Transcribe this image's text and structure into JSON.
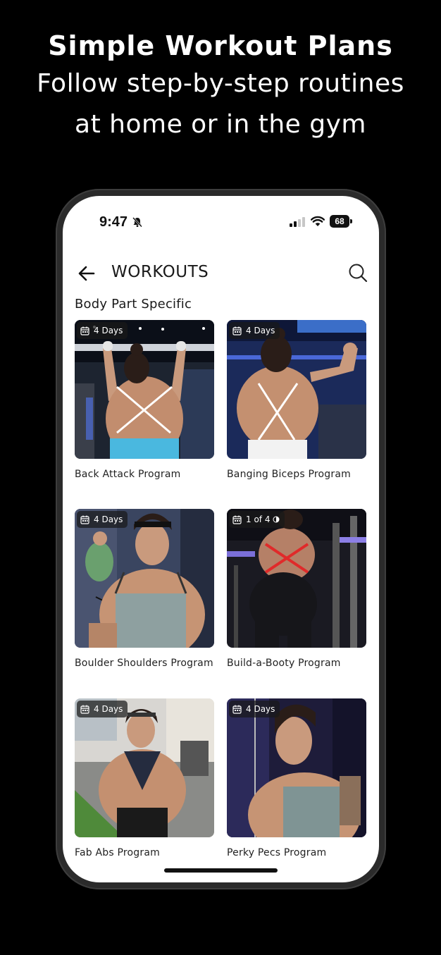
{
  "headline": {
    "title": "Simple Workout Plans",
    "line1": "Follow step-by-step routines",
    "line2": "at home or in the gym"
  },
  "status_bar": {
    "time": "9:47",
    "battery": "68"
  },
  "app_bar": {
    "title": "WORKOUTS",
    "back_icon": "arrow-left-icon",
    "search_icon": "search-icon"
  },
  "section": {
    "title": "Body Part Specific"
  },
  "programs": [
    {
      "name": "Back Attack Program",
      "badge": "4 Days"
    },
    {
      "name": "Banging Biceps Program",
      "badge": "4 Days"
    },
    {
      "name": "Boulder Shoulders Program",
      "badge": "4 Days"
    },
    {
      "name": "Build-a-Booty Program",
      "badge": "1 of 4"
    },
    {
      "name": "Fab Abs Program",
      "badge": "4 Days"
    },
    {
      "name": "Perky Pecs Program",
      "badge": "4 Days"
    }
  ],
  "colors": {
    "background": "#000000",
    "screen": "#ffffff",
    "text": "#1a1a1a"
  }
}
